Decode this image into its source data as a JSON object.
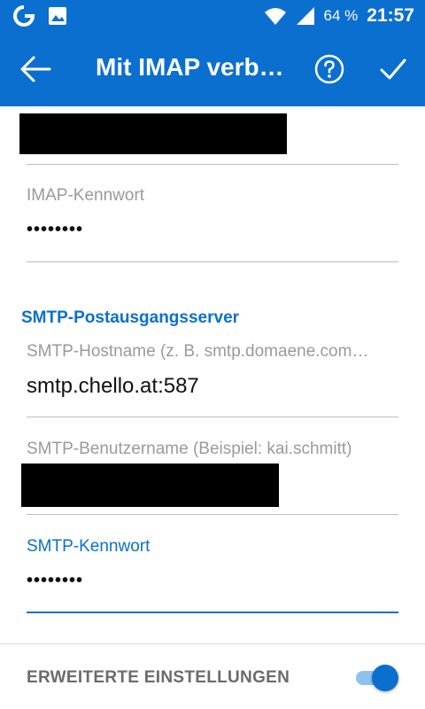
{
  "statusbar": {
    "time": "21:57",
    "battery": "64 %",
    "icons": [
      "will-app-icon",
      "image-icon",
      "wifi-icon",
      "signal-icon"
    ]
  },
  "header": {
    "title": "Mit IMAP verb…",
    "back_icon": "arrow-left-icon",
    "help_icon": "help-circle-icon",
    "confirm_icon": "checkmark-icon"
  },
  "imap": {
    "password_label": "IMAP-Kennwort",
    "password_value": "••••••••"
  },
  "smtp": {
    "section_title": "SMTP-Postausgangsserver",
    "hostname_label": "SMTP-Hostname (z. B. smtp.domaene.com…",
    "hostname_value": "smtp.chello.at:587",
    "username_label": "SMTP-Benutzername (Beispiel: kai.schmitt)",
    "password_label": "SMTP-Kennwort",
    "password_value": "••••••••"
  },
  "advanced": {
    "label": "ERWEITERTE EINSTELLUNGEN",
    "enabled": true
  },
  "colors": {
    "primary": "#0b6fd0",
    "label_gray": "#9a9a9a",
    "toggle_track": "#8ec1f0"
  }
}
